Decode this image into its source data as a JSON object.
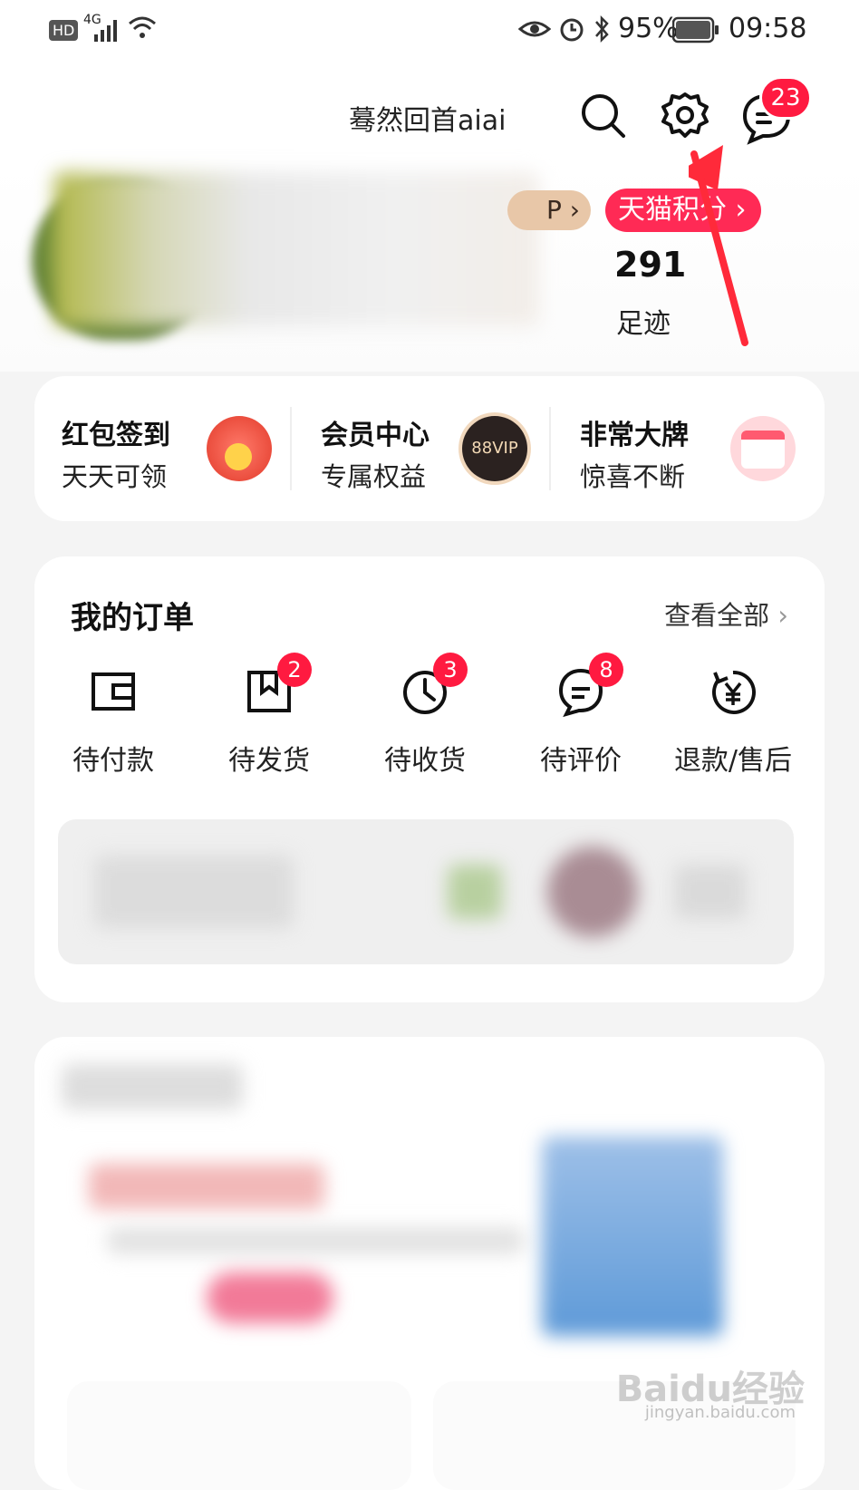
{
  "status_bar": {
    "hd": "HD",
    "network": "4G",
    "battery": "95%",
    "time": "09:58"
  },
  "header": {
    "username": "蓦然回首aiai",
    "message_count": "23"
  },
  "profile": {
    "vip_tag": "P",
    "tmall_points_label": "天猫积分",
    "footprint_count": "291",
    "footprint_label": "足迹"
  },
  "quick_entries": [
    {
      "title": "红包签到",
      "subtitle": "天天可领",
      "icon": "red-envelope-icon"
    },
    {
      "title": "会员中心",
      "subtitle": "专属权益",
      "icon": "88vip-icon",
      "icon_text": "88VIP"
    },
    {
      "title": "非常大牌",
      "subtitle": "惊喜不断",
      "icon": "calendar-icon"
    }
  ],
  "orders": {
    "title": "我的订单",
    "view_all": "查看全部",
    "items": [
      {
        "label": "待付款",
        "icon": "wallet-icon",
        "badge": ""
      },
      {
        "label": "待发货",
        "icon": "package-icon",
        "badge": "2"
      },
      {
        "label": "待收货",
        "icon": "clock-icon",
        "badge": "3"
      },
      {
        "label": "待评价",
        "icon": "comment-icon",
        "badge": "8"
      },
      {
        "label": "退款/售后",
        "icon": "refund-icon",
        "badge": ""
      }
    ]
  },
  "watermark": {
    "brand": "Baidu经验",
    "url": "jingyan.baidu.com"
  },
  "colors": {
    "accent": "#ff1a40",
    "vip": "#e8c7a8"
  }
}
